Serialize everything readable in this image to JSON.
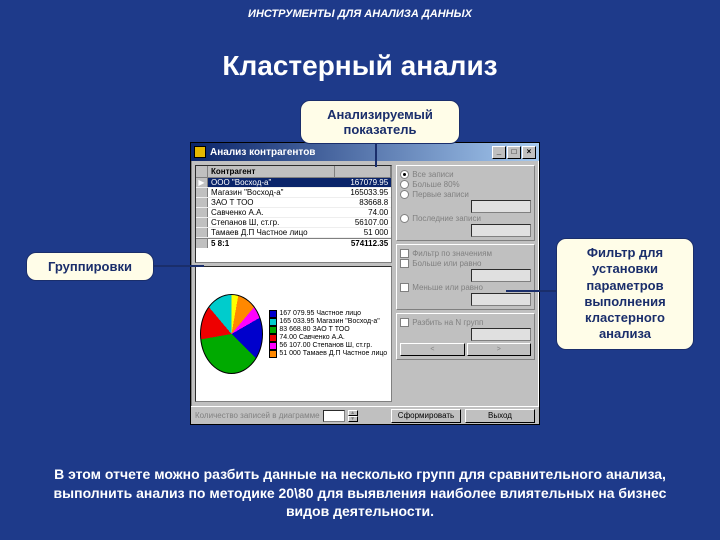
{
  "header": "ИНСТРУМЕНТЫ ДЛЯ АНАЛИЗА ДАННЫХ",
  "title": "Кластерный анализ",
  "callouts": {
    "top": "Анализируемый показатель",
    "left": "Группировки",
    "right": "Фильтр для установки параметров выполнения кластерного анализа"
  },
  "window": {
    "title": "Анализ контрагентов",
    "grid": {
      "col1": "Контрагент",
      "col2": "",
      "rows": [
        {
          "name": "ООО \"Восход-а\"",
          "val": "167079.95",
          "sel": true
        },
        {
          "name": "Магазин \"Восход-а\"",
          "val": "165033.95"
        },
        {
          "name": "ЗАО Т ТОО",
          "val": "83668.8"
        },
        {
          "name": "Савченко А.А.",
          "val": "74.00"
        },
        {
          "name": "Степанов Ш, ст.гр.",
          "val": "56107.00"
        },
        {
          "name": "Тамаев Д.П Частное лицо",
          "val": "51 000"
        }
      ],
      "total_label": "5 8:1",
      "total_value": "574112.35"
    },
    "legend": [
      {
        "color": "#00c",
        "label": "167 079.95 Частное лицо"
      },
      {
        "color": "#0cc",
        "label": "165 033.95 Магазин \"Восход-а\""
      },
      {
        "color": "#0a0",
        "label": "83 668.80 ЗАО Т ТОО"
      },
      {
        "color": "#e00",
        "label": "74.00 Савченко А.А."
      },
      {
        "color": "#f0f",
        "label": "56 107.00 Степанов Ш, ст.гр."
      },
      {
        "color": "#f80",
        "label": "51 000 Тамаев Д.П Частное лицо"
      }
    ],
    "filters": {
      "r1": "Все записи",
      "r2": "Больше 80%",
      "r3": "Первые записи",
      "r4": "Последние записи",
      "chk1": "Фильтр по значениям",
      "chk2": "Больше или равно",
      "chk3": "Меньше или равно",
      "chk4": "Разбить на N групп"
    },
    "bottom": {
      "label": "Количество записей в диаграмме",
      "btn1": "Сформировать",
      "btn2": "Выход"
    }
  },
  "footer": "В этом отчете можно  разбить данные на несколько групп для сравнительного анализа,  выполнить анализ по методике  20\\80 для выявления наиболее влиятельных на бизнес видов деятельности."
}
